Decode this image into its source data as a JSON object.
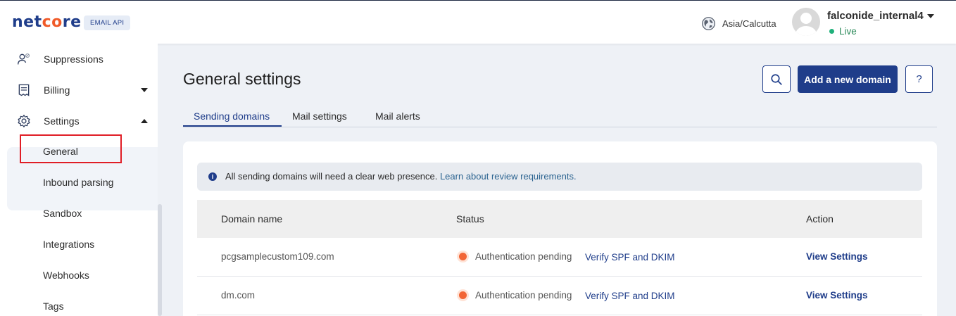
{
  "brand": {
    "logo_pre": "net",
    "logo_oo": "co",
    "logo_post": "re",
    "badge": "EMAIL API",
    "primary_color": "#1f3d8a",
    "accent_color": "#f05a28"
  },
  "header": {
    "timezone": "Asia/Calcutta",
    "user_name": "falconide_internal4",
    "status": "Live",
    "globe_icon": "globe-icon",
    "avatar_icon": "avatar-icon"
  },
  "sidebar": {
    "items": [
      {
        "label": "Suppressions",
        "icon": "user-block-icon"
      },
      {
        "label": "Billing",
        "icon": "billing-icon"
      },
      {
        "label": "Settings",
        "icon": "gear-icon"
      }
    ],
    "settings_children": [
      "General",
      "Inbound parsing",
      "Sandbox",
      "Integrations",
      "Webhooks",
      "Tags"
    ]
  },
  "main": {
    "title": "General settings",
    "add_button": "Add a new domain",
    "help_label": "?",
    "tabs": [
      "Sending domains",
      "Mail settings",
      "Mail alerts"
    ],
    "notice": {
      "text": "All sending domains will need a clear web presence. ",
      "link": "Learn about review requirements."
    },
    "table": {
      "headers": [
        "Domain name",
        "Status",
        "Action"
      ],
      "rows": [
        {
          "domain": "pcgsamplecustom109.com",
          "status": "Authentication pending",
          "verify": "Verify SPF and DKIM",
          "action": "View Settings"
        },
        {
          "domain": "dm.com",
          "status": "Authentication pending",
          "verify": "Verify SPF and DKIM",
          "action": "View Settings"
        }
      ]
    }
  }
}
